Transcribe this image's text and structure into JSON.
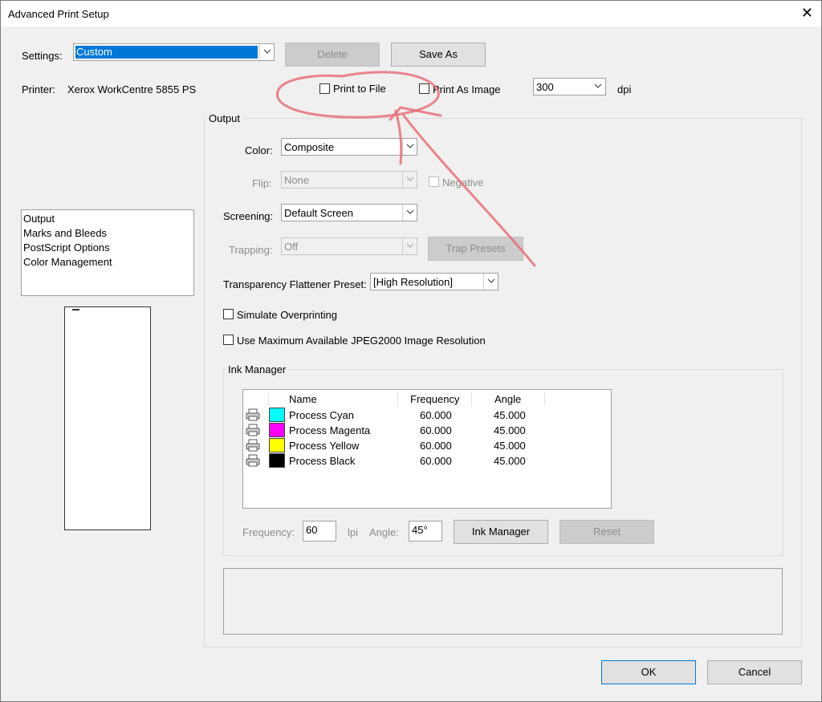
{
  "window": {
    "title": "Advanced Print Setup"
  },
  "settings": {
    "label": "Settings:",
    "value": "Custom",
    "delete_label": "Delete",
    "save_as_label": "Save As"
  },
  "printer": {
    "label": "Printer:",
    "name": "Xerox WorkCentre 5855 PS",
    "print_to_file_label": "Print to File",
    "print_as_image_label": "Print As Image",
    "dpi_value": "300",
    "dpi_unit": "dpi"
  },
  "sidebar": {
    "items": [
      "Output",
      "Marks and Bleeds",
      "PostScript Options",
      "Color Management"
    ]
  },
  "output": {
    "group_title": "Output",
    "color_label": "Color:",
    "color_value": "Composite",
    "flip_label": "Flip:",
    "flip_value": "None",
    "negative_label": "Negative",
    "screening_label": "Screening:",
    "screening_value": "Default Screen",
    "trapping_label": "Trapping:",
    "trapping_value": "Off",
    "trap_presets_label": "Trap Presets",
    "flattener_label": "Transparency Flattener Preset:",
    "flattener_value": "[High Resolution]",
    "simulate_overprinting_label": "Simulate Overprinting",
    "max_jpeg2000_label": "Use Maximum Available JPEG2000 Image Resolution"
  },
  "ink_manager": {
    "group_title": "Ink Manager",
    "columns": [
      "Name",
      "Frequency",
      "Angle"
    ],
    "inks": [
      {
        "name": "Process Cyan",
        "frequency": "60.000",
        "angle": "45.000",
        "color": "#00ffff"
      },
      {
        "name": "Process Magenta",
        "frequency": "60.000",
        "angle": "45.000",
        "color": "#ff00ff"
      },
      {
        "name": "Process Yellow",
        "frequency": "60.000",
        "angle": "45.000",
        "color": "#ffff00"
      },
      {
        "name": "Process Black",
        "frequency": "60.000",
        "angle": "45.000",
        "color": "#000000"
      }
    ],
    "frequency_label": "Frequency:",
    "frequency_value": "60",
    "frequency_unit": "lpi",
    "angle_label": "Angle:",
    "angle_value": "45°",
    "ink_manager_button": "Ink Manager",
    "reset_button": "Reset"
  },
  "footer": {
    "ok_label": "OK",
    "cancel_label": "Cancel"
  },
  "colors": {
    "selection": "#0078d7",
    "annotation": "#e8707a"
  }
}
